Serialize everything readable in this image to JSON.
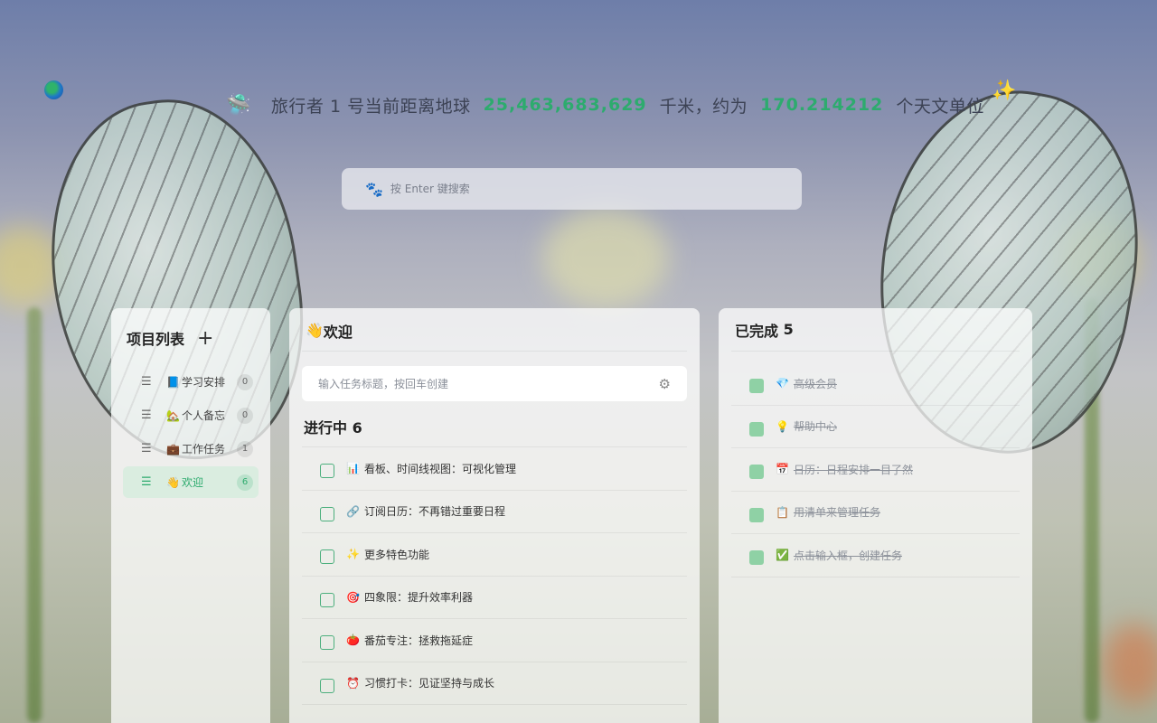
{
  "headline": {
    "icon": "ufo-icon",
    "prefix": "旅行者 1 号当前距离地球",
    "distance_km": "25,463,683,629",
    "km_unit": "千米，约为",
    "distance_au": "170.214212",
    "au_unit": "个天文单位",
    "sparkle": "✨"
  },
  "search": {
    "placeholder": "按 Enter 键搜索"
  },
  "projects": {
    "title": "项目列表",
    "add_label": "+",
    "items": [
      {
        "emoji": "📘",
        "name": "学习安排",
        "count": "0"
      },
      {
        "emoji": "🏡",
        "name": "个人备忘",
        "count": "0"
      },
      {
        "emoji": "💼",
        "name": "工作任务",
        "count": "1"
      },
      {
        "emoji": "👋",
        "name": "欢迎",
        "count": "6"
      }
    ]
  },
  "main": {
    "title_emoji": "👋",
    "title": "欢迎",
    "task_input_placeholder": "输入任务标题，按回车创建",
    "in_progress_label": "进行中",
    "in_progress_count": "6",
    "tasks": [
      {
        "emoji": "📊",
        "text": "看板、时间线视图：可视化管理"
      },
      {
        "emoji": "🔗",
        "text": "订阅日历：不再错过重要日程"
      },
      {
        "emoji": "✨",
        "text": "更多特色功能"
      },
      {
        "emoji": "🎯",
        "text": "四象限：提升效率利器"
      },
      {
        "emoji": "🍅",
        "text": "番茄专注：拯救拖延症"
      },
      {
        "emoji": "⏰",
        "text": "习惯打卡：见证坚持与成长"
      }
    ]
  },
  "done": {
    "title": "已完成",
    "count": "5",
    "items": [
      {
        "emoji": "💎",
        "text": "高级会员"
      },
      {
        "emoji": "💡",
        "text": "帮助中心"
      },
      {
        "emoji": "📅",
        "text": "日历：日程安排一目了然"
      },
      {
        "emoji": "📋",
        "text": "用清单来管理任务"
      },
      {
        "emoji": "✅",
        "text": "点击输入框，创建任务"
      }
    ]
  },
  "colors": {
    "accent": "#2dab6e",
    "search_icon": "#3d6fe0"
  }
}
